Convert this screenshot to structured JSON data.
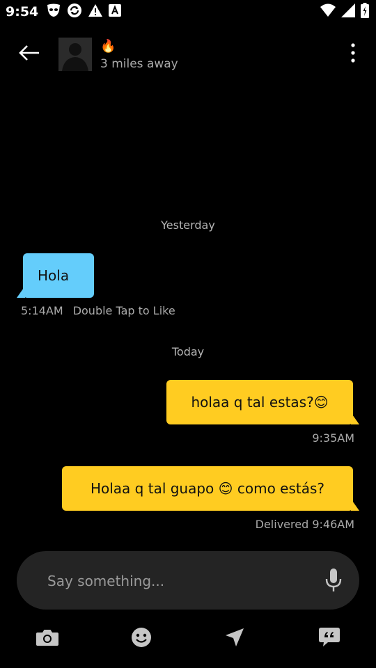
{
  "status_bar": {
    "time": "9:54",
    "left_icons": [
      "grindr-mask-icon",
      "sync-icon",
      "warning-icon",
      "font-a-icon"
    ],
    "right_icons": [
      "wifi-icon",
      "signal-icon",
      "battery-icon"
    ]
  },
  "header": {
    "back_icon": "arrow-left-icon",
    "avatar": "default-avatar-silhouette",
    "profile_emoji": "🔥",
    "distance": "3 miles away",
    "menu_icon": "more-vertical-icon"
  },
  "chat": {
    "sections": [
      {
        "date_label": "Yesterday",
        "messages": [
          {
            "direction": "incoming",
            "text": "Hola",
            "time": "5:14AM",
            "hint": "Double Tap to Like"
          }
        ]
      },
      {
        "date_label": "Today",
        "messages": [
          {
            "direction": "outgoing",
            "text": "holaa q tal estas?😊",
            "status": "9:35AM"
          },
          {
            "direction": "outgoing",
            "text": "Holaa q tal guapo 😊 como estás?",
            "status": "Delivered 9:46AM"
          }
        ]
      }
    ]
  },
  "composer": {
    "placeholder": "Say something...",
    "value": "",
    "mic_icon": "microphone-icon"
  },
  "toolbar": {
    "items": [
      "camera-icon",
      "emoji-face-icon",
      "location-arrow-icon",
      "saved-phrases-icon"
    ]
  },
  "colors": {
    "background": "#000000",
    "incoming_bubble": "#64cdfb",
    "outgoing_bubble": "#ffcc21",
    "muted_text": "#a9a9a9",
    "composer_bg": "#242424",
    "icon_gray": "#c6c6c6"
  }
}
